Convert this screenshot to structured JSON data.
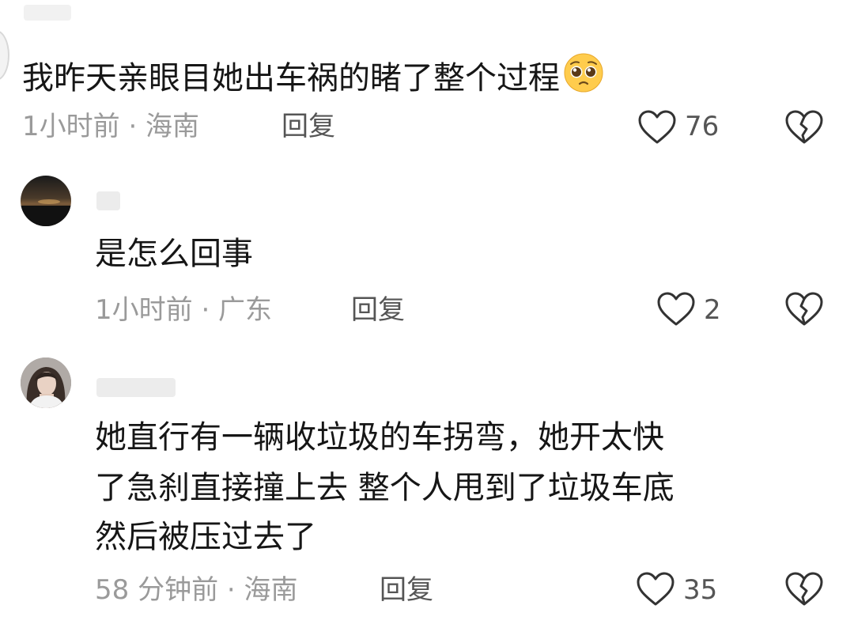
{
  "comments": [
    {
      "text": "我昨天亲眼目她出车祸的睹了整个过程",
      "emoji": "pleading-face-emoji",
      "time": "1小时前 · 海南",
      "reply_label": "回复",
      "likes": "76"
    },
    {
      "text": "是怎么回事",
      "time": "1小时前 · 广东",
      "reply_label": "回复",
      "likes": "2"
    },
    {
      "lines": [
        "她直行有一辆收垃圾的车拐弯，她开太快",
        "了急刹直接撞上去 整个人甩到了垃圾车底",
        "然后被压过去了"
      ],
      "time": "58 分钟前 · 海南",
      "reply_label": "回复",
      "likes": "35"
    }
  ],
  "colors": {
    "text": "#161616",
    "meta": "#9a9a9a",
    "icon": "#333333"
  }
}
